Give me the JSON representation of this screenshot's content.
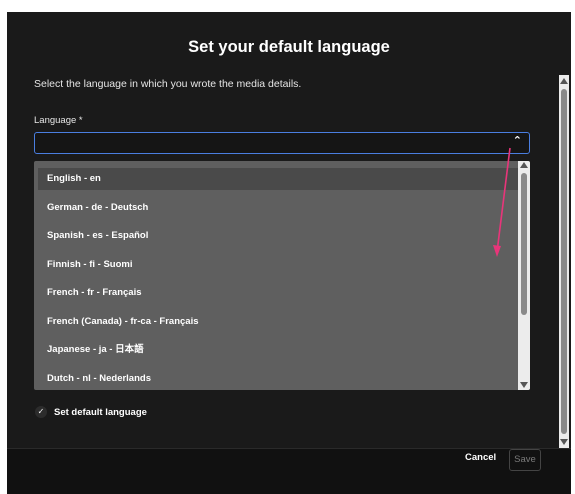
{
  "dialog": {
    "title": "Set your default language",
    "description": "Select the language in which you wrote the media details."
  },
  "language_field": {
    "label": "Language *",
    "value": "",
    "caret_icon": "chevron-up-icon"
  },
  "dropdown": {
    "options": [
      "English - en",
      "German - de - Deutsch",
      "Spanish - es - Español",
      "Finnish - fi - Suomi",
      "French - fr - Français",
      "French (Canada) - fr-ca - Français",
      "Japanese - ja - 日本語",
      "Dutch - nl - Nederlands"
    ],
    "highlighted_index": 0
  },
  "set_default": {
    "label": "Set default language",
    "checked": true,
    "check_icon": "check-icon"
  },
  "footer": {
    "cancel_label": "Cancel",
    "save_label": "Save"
  },
  "colors": {
    "background": "#1a1a1a",
    "dropdown_bg": "#5f5f5f",
    "focus_border": "#4a7ee0",
    "annotation_arrow": "#e8357a"
  }
}
